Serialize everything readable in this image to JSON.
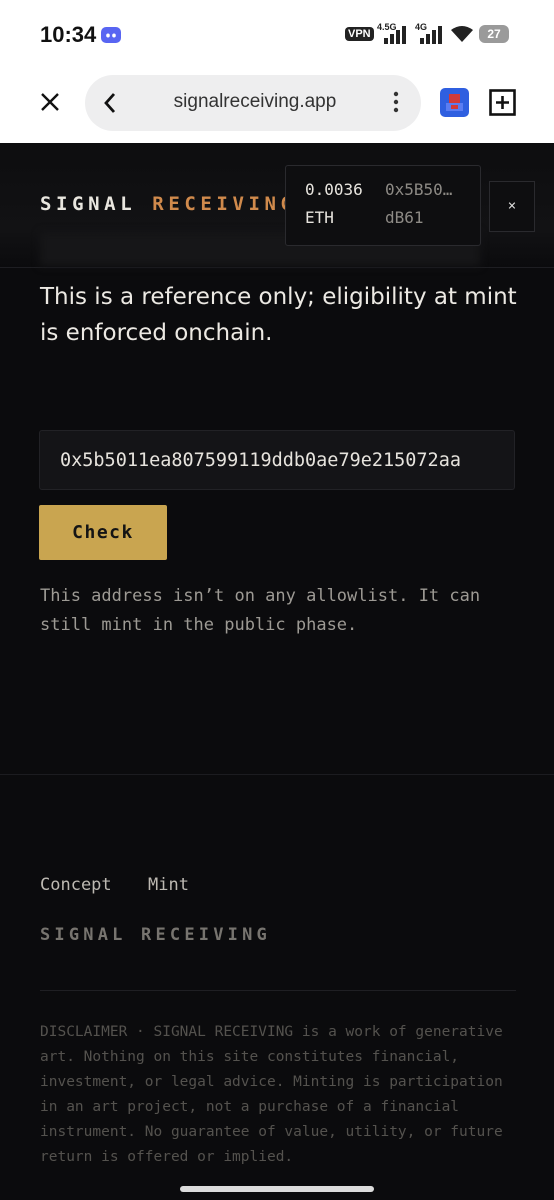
{
  "status": {
    "time": "10:34",
    "vpn": "VPN",
    "net1": "4.5G",
    "net2": "4G",
    "battery": "27"
  },
  "browser": {
    "url": "signalreceiving.app"
  },
  "header": {
    "brand_part1": "SIGNAL",
    "brand_part2": "RECEIVING",
    "wallet_balance_line1": "0.0036",
    "wallet_balance_line2": "ETH",
    "wallet_address_line1": "0x5B50…",
    "wallet_address_line2": "dB61",
    "close_label": "×"
  },
  "main": {
    "note": "This is a reference only; eligibility at mint is enforced onchain.",
    "address_value": "0x5b5011ea807599119ddb0ae79e215072aa",
    "check_label": "Check",
    "result": "This address isn’t on any allowlist. It can still mint in the public phase."
  },
  "footer": {
    "nav": [
      "Concept",
      "Mint"
    ],
    "brand": "SIGNAL RECEIVING",
    "disclaimer": "DISCLAIMER · SIGNAL RECEIVING is a work of generative art. Nothing on this site constitutes financial, investment, or legal advice. Minting is participation in an art project, not a purchase of a financial instrument. No guarantee of value, utility, or future return is offered or implied."
  },
  "colors": {
    "accent": "#d08a4c",
    "button": "#c9a550",
    "background": "#0b0b0d"
  },
  "icons": [
    "discord-icon",
    "signal-icon",
    "wifi-icon",
    "close-icon",
    "chevron-left-icon",
    "more-vert-icon",
    "extension-icon",
    "new-tab-icon"
  ]
}
